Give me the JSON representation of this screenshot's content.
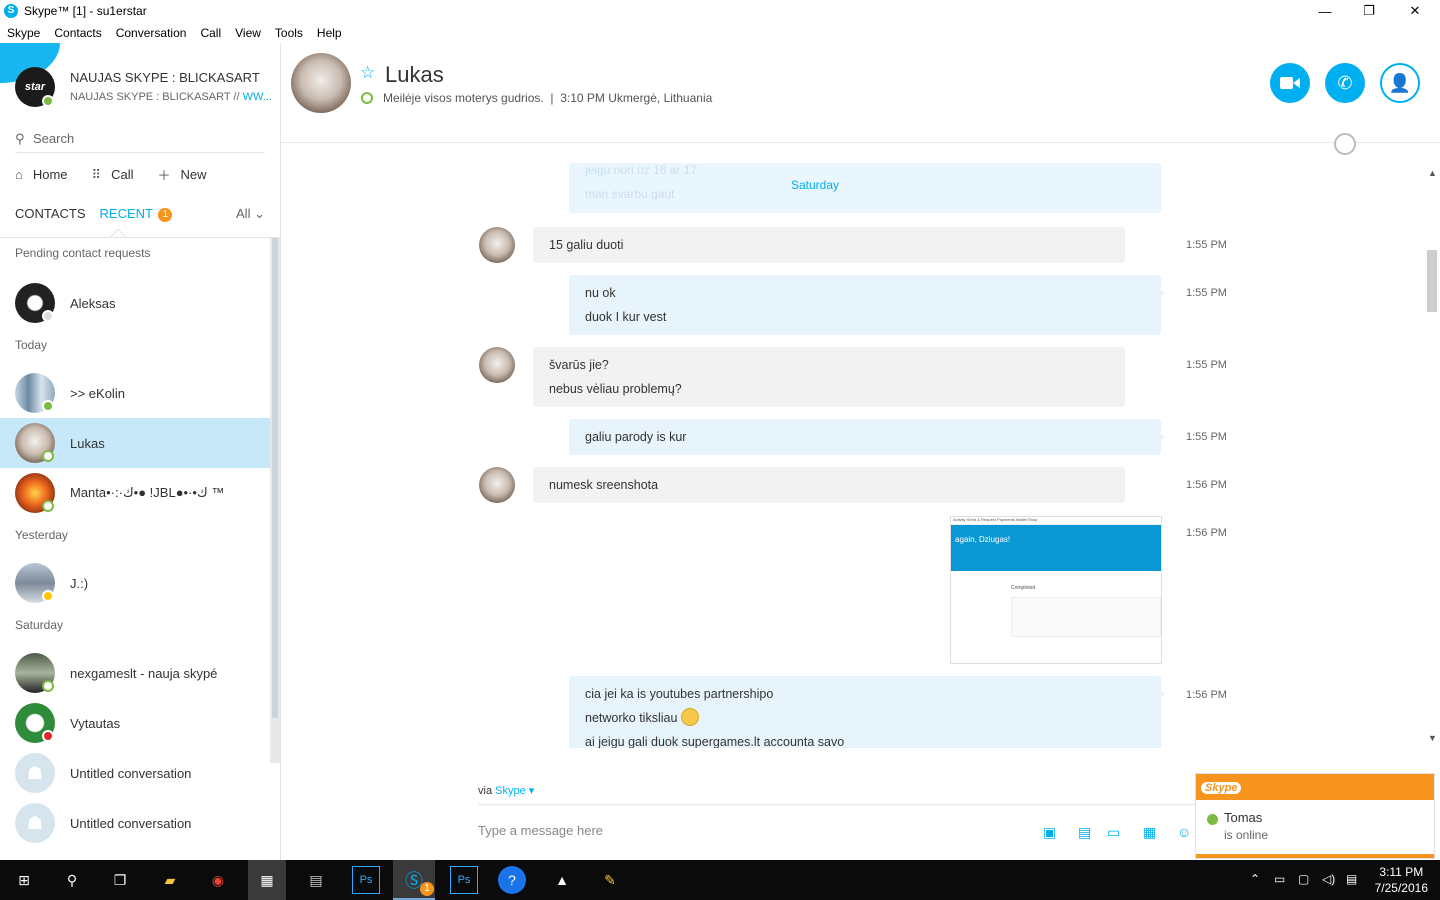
{
  "window": {
    "title": "Skype™ [1] - su1erstar"
  },
  "menu": [
    "Skype",
    "Contacts",
    "Conversation",
    "Call",
    "View",
    "Tools",
    "Help"
  ],
  "profile": {
    "avatar_text": "star",
    "name": "NAUJAS SKYPE : BLICKASART",
    "mood": "NAUJAS SKYPE : BLICKASART // ",
    "mood_link": "WW...",
    "status_color": "#7cbb42"
  },
  "search": {
    "placeholder": "Search"
  },
  "nav": {
    "home": "Home",
    "call": "Call",
    "new": "New"
  },
  "tabs": {
    "contacts": "CONTACTS",
    "recent": "RECENT",
    "recent_badge": "1",
    "filter": "All"
  },
  "sections": {
    "pending": "Pending contact requests",
    "today": "Today",
    "yesterday": "Yesterday",
    "saturday": "Saturday"
  },
  "contacts": [
    {
      "name": "Aleksas",
      "status": "pending"
    },
    {
      "name": ">> eKolin",
      "status": "online"
    },
    {
      "name": "Lukas",
      "status": "online-ring",
      "selected": true
    },
    {
      "name": "Manta•·:·ك•● !JBL●•·•ك ™",
      "status": "online-ring"
    },
    {
      "name": "J.:)",
      "status": "away"
    },
    {
      "name": "nexgameslt - nauja skypé",
      "status": "online-ring"
    },
    {
      "name": "Vytautas",
      "status": "dnd"
    },
    {
      "name": "Untitled conversation",
      "status": "group"
    },
    {
      "name": "Untitled conversation",
      "status": "group"
    }
  ],
  "conversation": {
    "name": "Lukas",
    "mood": "Meilėje visos moterys gudrios.",
    "separator": "|",
    "time_location": "3:10 PM Ukmergė, Lithuania",
    "day_label": "Saturday",
    "faded_lines": [
      "jeigu nori uz 16 ar 17",
      "man svarbu gaut"
    ],
    "messages": [
      {
        "dir": "in",
        "lines": [
          "15 galiu duoti"
        ],
        "time": "1:55 PM"
      },
      {
        "dir": "out",
        "lines": [
          "nu ok",
          "duok I kur vest"
        ],
        "time": "1:55 PM"
      },
      {
        "dir": "in",
        "lines": [
          "švarūs jie?",
          "nebus vėliau problemų?"
        ],
        "time": "1:55 PM"
      },
      {
        "dir": "out",
        "lines": [
          "galiu parody is kur"
        ],
        "time": "1:55 PM"
      },
      {
        "dir": "in",
        "lines": [
          "numesk sreenshota"
        ],
        "time": "1:56 PM"
      },
      {
        "dir": "out-image",
        "time": "1:56 PM",
        "image_banner": "again, Dziugas!",
        "image_tabs": "Activity   Send & Request Payments   Wallet   Shop",
        "image_label": "Completed"
      },
      {
        "dir": "out",
        "lines": [
          "cia jei ka is youtubes partnershipo",
          "networko tiksliau",
          "ai jeigu gali duok supergames.lt accounta savo"
        ],
        "time": "1:56 PM"
      }
    ]
  },
  "composer": {
    "via": "via",
    "via_service": "Skype",
    "placeholder": "Type a message here"
  },
  "toast": {
    "brand": "Skype",
    "name": "Tomas",
    "status": "is online"
  },
  "taskbar": {
    "time": "3:11 PM",
    "date": "7/25/2016",
    "skype_badge": "1"
  },
  "colors": {
    "accent": "#00aff0",
    "selected_row": "#c6e8f8",
    "badge": "#f7941e",
    "online": "#7cbb42"
  }
}
